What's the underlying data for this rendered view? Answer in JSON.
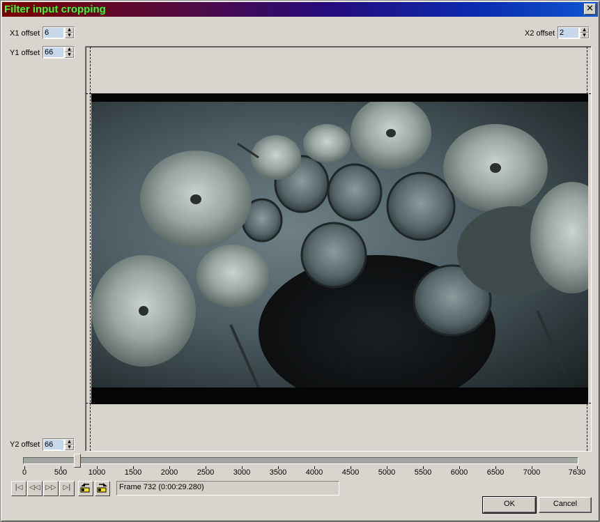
{
  "window": {
    "title": "Filter input cropping",
    "close_glyph": "✕"
  },
  "fields": {
    "x1": {
      "label": "X1 offset",
      "value": "6"
    },
    "y1": {
      "label": "Y1 offset",
      "value": "66"
    },
    "x2": {
      "label": "X2 offset",
      "value": "2"
    },
    "y2": {
      "label": "Y2 offset",
      "value": "66"
    }
  },
  "preview": {
    "icon": "video-frame-drum-kit"
  },
  "slider": {
    "min": 0,
    "max": 7630,
    "value": 732,
    "ticks": [
      "0",
      "500",
      "1000",
      "1500",
      "2000",
      "2500",
      "3000",
      "3500",
      "4000",
      "4500",
      "5000",
      "5500",
      "6000",
      "6500",
      "7000",
      "7630"
    ]
  },
  "navigation": {
    "first_glyph": "|◁",
    "prev_glyph": "◁◁",
    "next_glyph": "▷▷",
    "last_glyph": "▷|",
    "prev_key_icon": "key-prev-icon",
    "next_key_icon": "key-next-icon"
  },
  "status": {
    "frame_text": "Frame 732 (0:00:29.280)"
  },
  "buttons": {
    "ok": "OK",
    "cancel": "Cancel"
  },
  "colors": {
    "title_text": "#33ff33",
    "input_highlight": "#c6d8ea"
  }
}
